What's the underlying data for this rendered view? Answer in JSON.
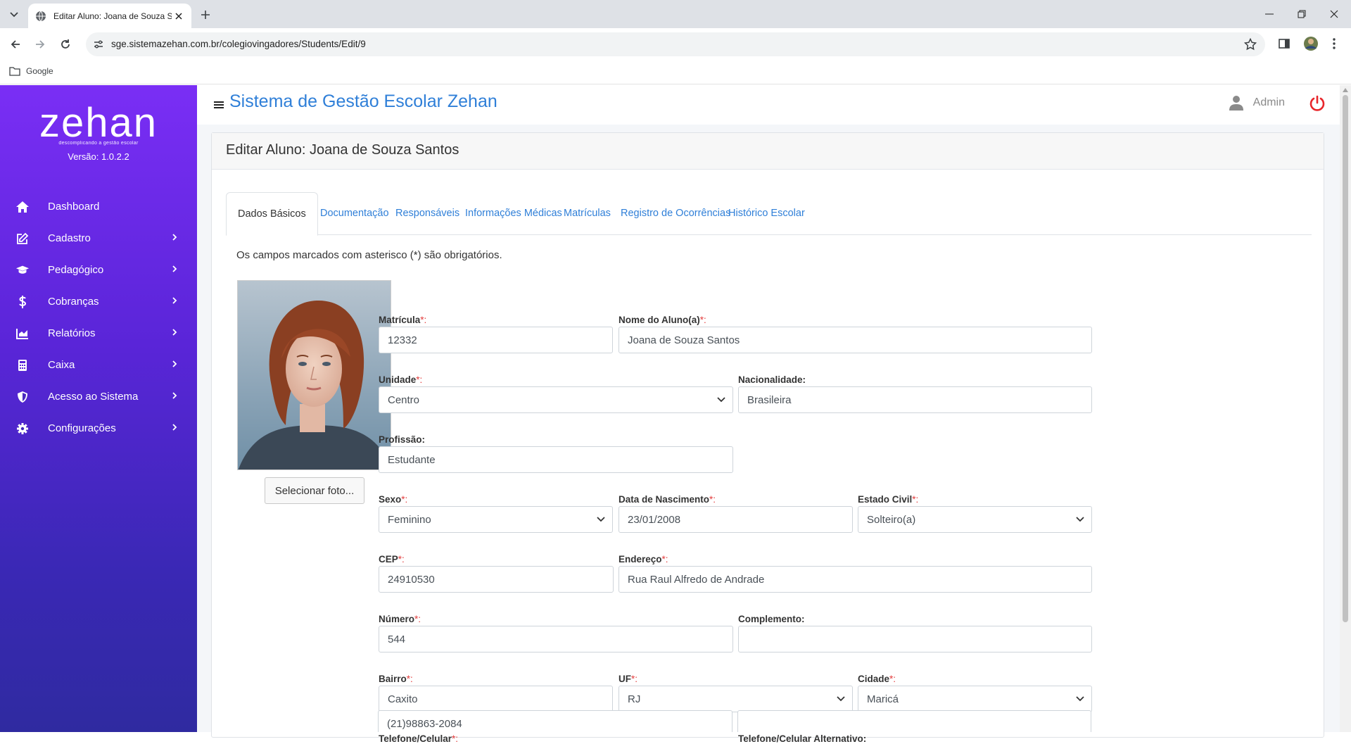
{
  "browser": {
    "tab_title": "Editar Aluno: Joana de Souza Santos",
    "url": "sge.sistemazehan.com.br/colegiovingadores/Students/Edit/9",
    "bookmark": "Google"
  },
  "sidebar": {
    "logo_text": "zehan",
    "logo_tagline": "descomplicando a gestão escolar",
    "version": "Versão: 1.0.2.2",
    "items": [
      {
        "label": "Dashboard",
        "icon": "home-icon"
      },
      {
        "label": "Cadastro",
        "icon": "edit-icon"
      },
      {
        "label": "Pedagógico",
        "icon": "graduation-cap-icon"
      },
      {
        "label": "Cobranças",
        "icon": "dollar-icon"
      },
      {
        "label": "Relatórios",
        "icon": "chart-icon"
      },
      {
        "label": "Caixa",
        "icon": "calculator-icon"
      },
      {
        "label": "Acesso ao Sistema",
        "icon": "shield-icon"
      },
      {
        "label": "Configurações",
        "icon": "gear-icon"
      }
    ]
  },
  "header": {
    "title": "Sistema de Gestão Escolar Zehan",
    "user": "Admin"
  },
  "card": {
    "title": "Editar Aluno: Joana de Souza Santos",
    "tabs": [
      "Dados Básicos",
      "Documentação",
      "Responsáveis",
      "Informações Médicas",
      "Matrículas",
      "Registro de Ocorrências",
      "Histórico Escolar"
    ],
    "note": "Os campos marcados com asterisco (*) são obrigatórios.",
    "select_photo": "Selecionar foto..."
  },
  "form": {
    "matricula": {
      "label": "Matrícula",
      "value": "12332"
    },
    "nome": {
      "label": "Nome do Aluno(a)",
      "value": "Joana de Souza Santos"
    },
    "unidade": {
      "label": "Unidade",
      "value": "Centro"
    },
    "nacionalidade": {
      "label": "Nacionalidade:",
      "value": "Brasileira"
    },
    "profissao": {
      "label": "Profissão:",
      "value": "Estudante"
    },
    "sexo": {
      "label": "Sexo",
      "value": "Feminino"
    },
    "nascimento": {
      "label": "Data de Nascimento",
      "value": "23/01/2008"
    },
    "estado_civil": {
      "label": "Estado Civil",
      "value": "Solteiro(a)"
    },
    "cep": {
      "label": "CEP",
      "value": "24910530"
    },
    "endereco": {
      "label": "Endereço",
      "value": "Rua Raul Alfredo de Andrade"
    },
    "numero": {
      "label": "Número",
      "value": "544"
    },
    "complemento": {
      "label": "Complemento:",
      "value": ""
    },
    "bairro": {
      "label": "Bairro",
      "value": "Caxito"
    },
    "uf": {
      "label": "UF",
      "value": "RJ"
    },
    "cidade": {
      "label": "Cidade",
      "value": "Maricá"
    },
    "telefone": {
      "label": "Telefone/Celular",
      "value": "(21)98863-2084"
    },
    "telefone_alt": {
      "label": "Telefone/Celular Alternativo:",
      "value": ""
    },
    "required_mark": "*:"
  }
}
